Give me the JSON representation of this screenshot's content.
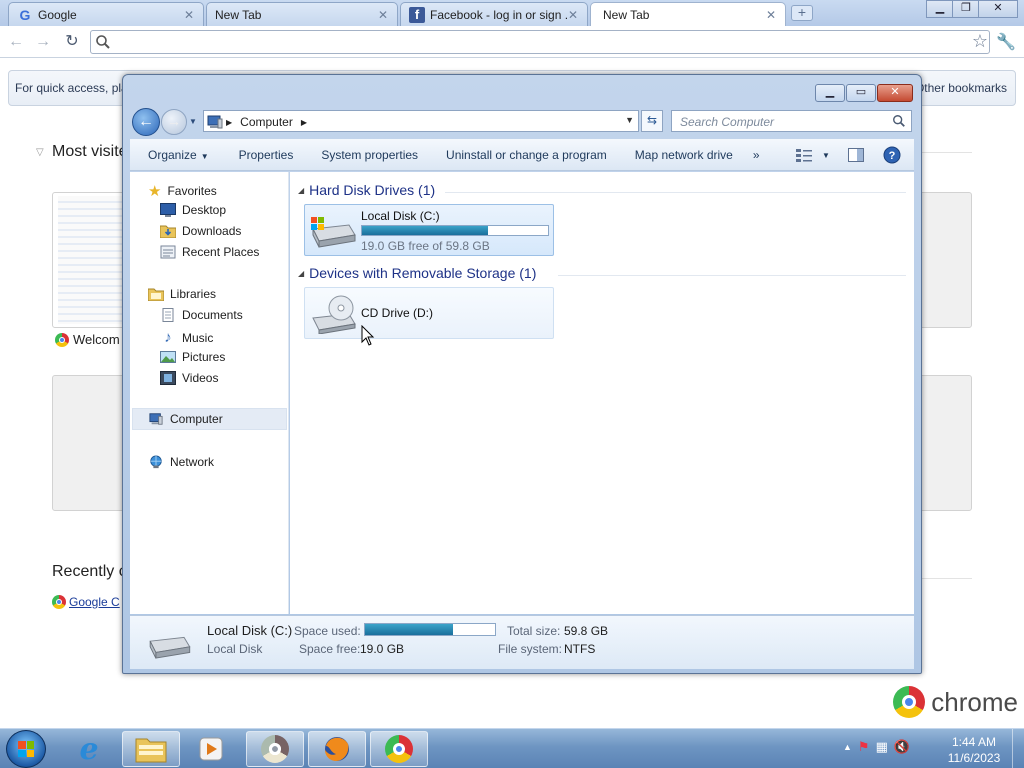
{
  "browser": {
    "tabs": [
      {
        "title": "Google",
        "icon": "google-icon"
      },
      {
        "title": "New Tab",
        "icon": "none"
      },
      {
        "title": "Facebook - log in or sign ...",
        "icon": "facebook-icon"
      },
      {
        "title": "New Tab",
        "icon": "none",
        "active": true
      }
    ],
    "omnibox_value": "",
    "bookmarks_prompt": "For quick access, pla",
    "other_bookmarks": "Other bookmarks",
    "ntp": {
      "most_visited_heading": "Most visite",
      "welcome_label": "Welcom",
      "recently_closed_heading": "Recently c",
      "recent_link": "Google C"
    },
    "brand": "chrome"
  },
  "explorer": {
    "breadcrumb": [
      "Computer"
    ],
    "search_placeholder": "Search Computer",
    "commands": [
      "Organize",
      "Properties",
      "System properties",
      "Uninstall or change a program",
      "Map network drive"
    ],
    "overflow_label": "»",
    "nav": {
      "favorites": {
        "label": "Favorites",
        "items": [
          "Desktop",
          "Downloads",
          "Recent Places"
        ]
      },
      "libraries": {
        "label": "Libraries",
        "items": [
          "Documents",
          "Music",
          "Pictures",
          "Videos"
        ]
      },
      "computer": "Computer",
      "network": "Network"
    },
    "groups": {
      "hdd": {
        "heading": "Hard Disk Drives (1)",
        "drive": {
          "name": "Local Disk (C:)",
          "free_text": "19.0 GB free of 59.8 GB",
          "used_fraction": 0.68
        }
      },
      "removable": {
        "heading": "Devices with Removable Storage (1)",
        "drive": {
          "name": "CD Drive (D:)"
        }
      }
    },
    "details": {
      "name": "Local Disk (C:)",
      "type": "Local Disk",
      "space_used_label": "Space used:",
      "space_free_label": "Space free:",
      "space_free": "19.0 GB",
      "total_size_label": "Total size:",
      "total_size": "59.8 GB",
      "file_system_label": "File system:",
      "file_system": "NTFS",
      "used_fraction": 0.68
    }
  },
  "taskbar": {
    "time": "1:44 AM",
    "date": "11/6/2023",
    "pinned": [
      "internet-explorer-icon",
      "windows-explorer-icon",
      "media-player-icon",
      "chrome-icon",
      "firefox-icon",
      "chrome-icon"
    ]
  },
  "colors": {
    "accent": "#1e3287",
    "bar_fill": "#1a6f9c",
    "taskbar": "#6e95c2"
  }
}
